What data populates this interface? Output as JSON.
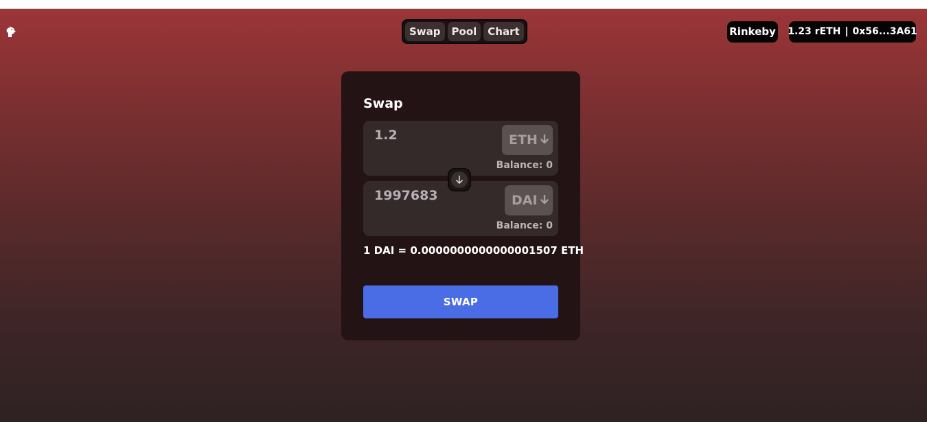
{
  "nav": {
    "items": [
      {
        "label": "Swap"
      },
      {
        "label": "Pool"
      },
      {
        "label": "Chart"
      }
    ]
  },
  "network": {
    "label": "Rinkeby"
  },
  "account": {
    "balance": "1.23 rETH",
    "separator": "|",
    "address": "0x56...3A61"
  },
  "swap_card": {
    "title": "Swap",
    "from": {
      "value": "1.2",
      "token": "ETH",
      "balance": "Balance: 0"
    },
    "to": {
      "value": "1997683",
      "token": "DAI",
      "balance": "Balance: 0"
    },
    "rate": "1 DAI = 0.0000000000000001507 ETH",
    "submit_label": "SWAP"
  },
  "icons": {
    "logo": "unicorn-icon",
    "token_chevron": "arrow-down-icon",
    "flip": "arrow-down-icon"
  },
  "colors": {
    "accent": "#4a6ce5",
    "card_bg": "#231314",
    "gradient_top": "#9b3538",
    "gradient_bottom": "#2e2223"
  }
}
